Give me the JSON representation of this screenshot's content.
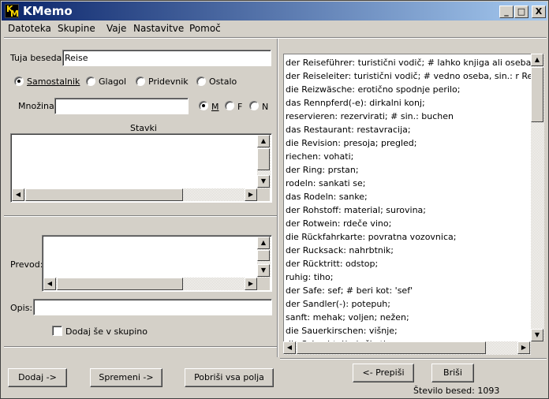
{
  "window": {
    "title": "KMemo",
    "icon": "kmemo-app-icon",
    "icon_text_k": "K",
    "icon_text_m": "M"
  },
  "title_buttons": {
    "minimize": "_",
    "maximize": "□",
    "close": "X"
  },
  "menu": [
    "Datoteka",
    "Skupine",
    "Vaje",
    "Nastavitve",
    "Pomoč"
  ],
  "form": {
    "foreign_word_label": "Tuja beseda:",
    "foreign_word_value": "Reise",
    "word_types": [
      {
        "label": "Samostalnik",
        "selected": true
      },
      {
        "label": "Glagol",
        "selected": false
      },
      {
        "label": "Pridevnik",
        "selected": false
      },
      {
        "label": "Ostalo",
        "selected": false
      }
    ],
    "plural_label": "Množina:",
    "plural_value": "",
    "genders": [
      {
        "label": "M",
        "selected": true
      },
      {
        "label": "F",
        "selected": false
      },
      {
        "label": "N",
        "selected": false
      }
    ],
    "sentences_label": "Stavki",
    "translation_label": "Prevod:",
    "description_label": "Opis:",
    "add_to_group_label": "Dodaj še v skupino",
    "add_to_group_checked": false
  },
  "buttons": {
    "add": "Dodaj ->",
    "modify": "Spremeni ->",
    "clear": "Pobriši vsa polja",
    "copy_back": "<- Prepiši",
    "delete": "Briši"
  },
  "word_count_text": "Število besed: 1093",
  "arrows": {
    "up": "▲",
    "down": "▼",
    "left": "◀",
    "right": "▶"
  },
  "word_list": [
    "der Reiseführer:  turistični vodič;  # lahko knjiga ali oseba, sin.: r R",
    "der Reiseleiter:  turistični vodič;  # vedno oseba, sin.: r Reiseführ",
    "die Reizwäsche:  erotično spodnje perilo;",
    "das Rennpferd(-e):  dirkalni konj;",
    "reservieren:  rezervirati;  # sin.: buchen",
    "das Restaurant:  restavracija;",
    "die Revision:  presoja; pregled;",
    "riechen:  vohati;",
    "der Ring:  prstan;",
    "rodeln:  sankati se;",
    "das Rodeln:  sanke;",
    "der Rohstoff:  material; surovina;",
    "der Rotwein:  rdeče vino;",
    "die Rückfahrkarte:  povratna vozovnica;",
    "der Rucksack:  nahrbtnik;",
    "der Rücktritt:  odstop;",
    "ruhig:  tiho;",
    "der Safe:  sef;  # beri kot: 'sef'",
    "der Sandler(-):  potepuh;",
    "sanft:  mehak; voljen; nežen;",
    "die Sauerkirschen:  višnje;",
    "die Schachtel(-n):  škatla;"
  ]
}
